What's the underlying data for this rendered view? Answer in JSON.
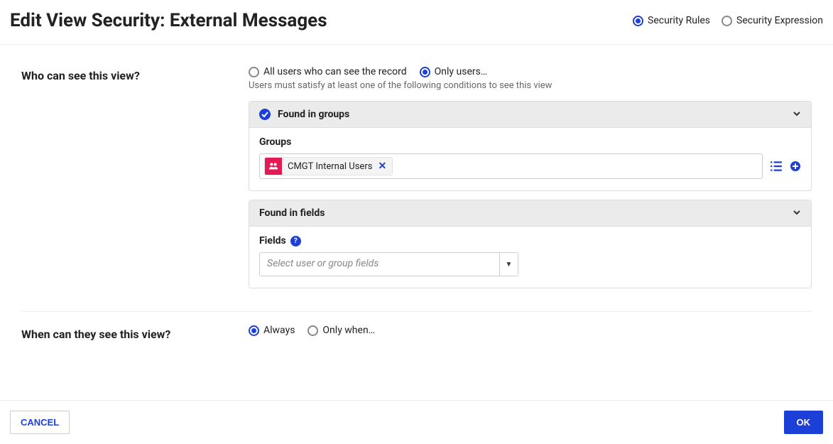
{
  "title": "Edit View Security: External Messages",
  "modeTabs": {
    "rules": "Security Rules",
    "expression": "Security Expression"
  },
  "who": {
    "label": "Who can see this view?",
    "optAll": "All users who can see the record",
    "optOnly": "Only users…",
    "helper": "Users must satisfy at least one of the following conditions to see this view"
  },
  "groupsPanel": {
    "title": "Found in groups",
    "fieldLabel": "Groups",
    "selected": "CMGT Internal Users"
  },
  "fieldsPanel": {
    "title": "Found in fields",
    "fieldLabel": "Fields",
    "placeholder": "Select user or group fields"
  },
  "when": {
    "label": "When can they see this view?",
    "optAlways": "Always",
    "optOnly": "Only when…"
  },
  "buttons": {
    "cancel": "CANCEL",
    "ok": "OK"
  }
}
